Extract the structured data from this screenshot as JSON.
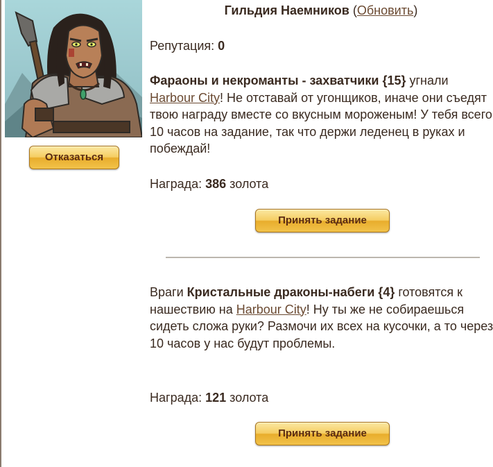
{
  "header": {
    "title": "Гильдия Наемников",
    "open_paren": "(",
    "refresh_label": "Обновить",
    "close_paren": ")"
  },
  "reputation": {
    "label": "Репутация: ",
    "value": "0"
  },
  "decline_button": "Отказаться",
  "quests": [
    {
      "enemy": "Фараоны и некроманты - захватчики {15}",
      "text_before_city": " угнали ",
      "city": "Harbour City",
      "text_after_city": "! Не отставай от угонщиков, иначе они съедят твою награду вместе со вкусным мороженым! У тебя всего 10 часов на задание, так что держи леденец в руках и побеждай!",
      "reward_label": "Награда: ",
      "reward_value": "386",
      "reward_unit": " золота",
      "accept_label": "Принять задание"
    },
    {
      "text_prefix": "Враги ",
      "enemy": "Кристальные драконы-набеги {4}",
      "text_before_city": " готовятся к нашествию на ",
      "city": "Harbour City",
      "text_after_city": "! Ну ты же не собираешься сидеть сложа руки? Размочи их всех на кусочки, а то через 10 часов у нас будут проблемы.",
      "reward_label": "Награда: ",
      "reward_value": "121",
      "reward_unit": " золота",
      "accept_label": "Принять задание"
    }
  ],
  "colors": {
    "text": "#3a2a20",
    "button_gold": "#f5cd62",
    "button_text": "#5a2b12",
    "divider": "#bcb6ae"
  }
}
